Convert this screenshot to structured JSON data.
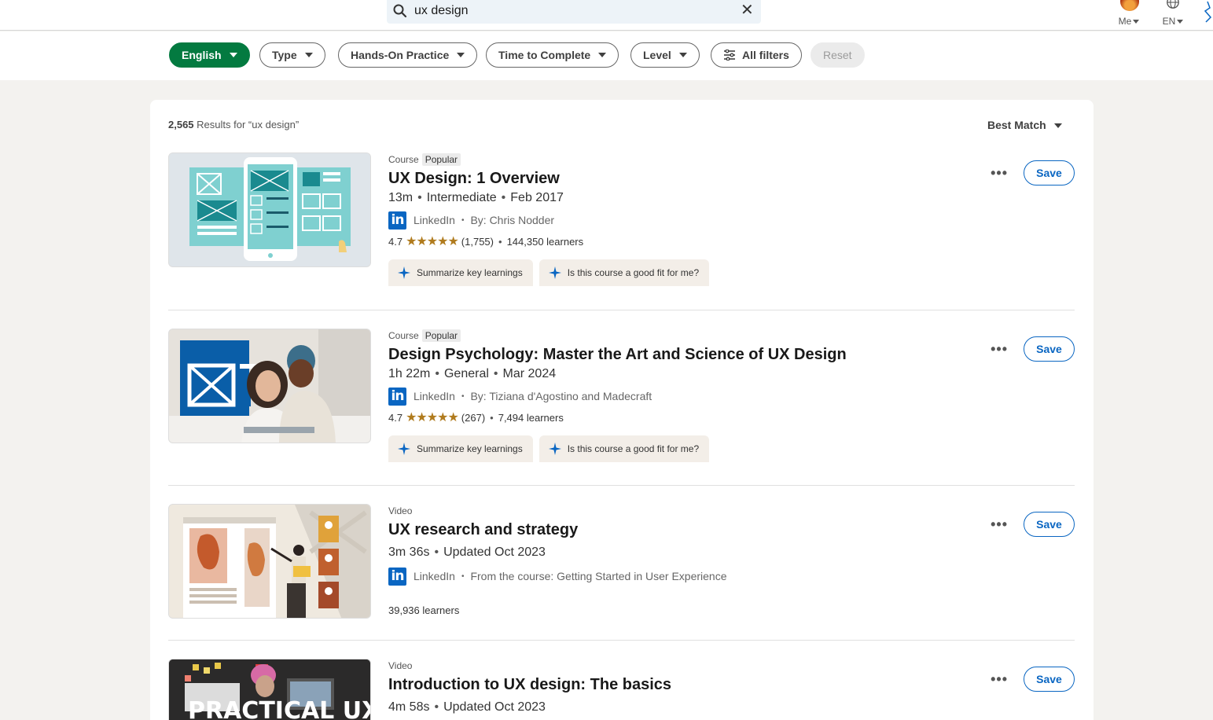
{
  "search": {
    "query": "ux design"
  },
  "nav": {
    "me_label": "Me",
    "lang_label": "EN"
  },
  "filters": [
    {
      "label": "English",
      "active": true
    },
    {
      "label": "Type"
    },
    {
      "label": "Hands-On Practice"
    },
    {
      "label": "Time to Complete"
    },
    {
      "label": "Level"
    },
    {
      "label": "All filters"
    },
    {
      "label": "Reset"
    }
  ],
  "results": {
    "count": "2,565",
    "count_suffix": "Results for “ux design”",
    "sort_label": "Best Match"
  },
  "items": [
    {
      "type": "Course",
      "badge": "Popular",
      "title": "UX Design: 1 Overview",
      "duration": "13m",
      "level": "Intermediate",
      "date": "Feb 2017",
      "provider": "LinkedIn",
      "author": "By: Chris Nodder",
      "rating": "4.7",
      "stars": "★★★★★",
      "reviews": "(1,755)",
      "learners": "144,350 learners",
      "ai_1": "Summarize key learnings",
      "ai_2": "Is this course a good fit for me?",
      "save": "Save"
    },
    {
      "type": "Course",
      "badge": "Popular",
      "title": "Design Psychology: Master the Art and Science of UX Design",
      "duration": "1h 22m",
      "level": "General",
      "date": "Mar 2024",
      "provider": "LinkedIn",
      "author": "By: Tiziana d'Agostino and Madecraft",
      "rating": "4.7",
      "stars": "★★★★★",
      "reviews": "(267)",
      "learners": "7,494 learners",
      "ai_1": "Summarize key learnings",
      "ai_2": "Is this course a good fit for me?",
      "save": "Save"
    },
    {
      "type": "Video",
      "title": "UX research and strategy",
      "duration": "3m 36s",
      "date": "Updated Oct 2023",
      "provider": "LinkedIn",
      "author": "From the course: Getting Started in User Experience",
      "learners": "39,936 learners",
      "save": "Save"
    },
    {
      "type": "Video",
      "title": "Introduction to UX design: The basics",
      "duration": "4m 58s",
      "date": "Updated Oct 2023",
      "thumb_text": "PRACTICAL UX",
      "save": "Save"
    }
  ]
}
